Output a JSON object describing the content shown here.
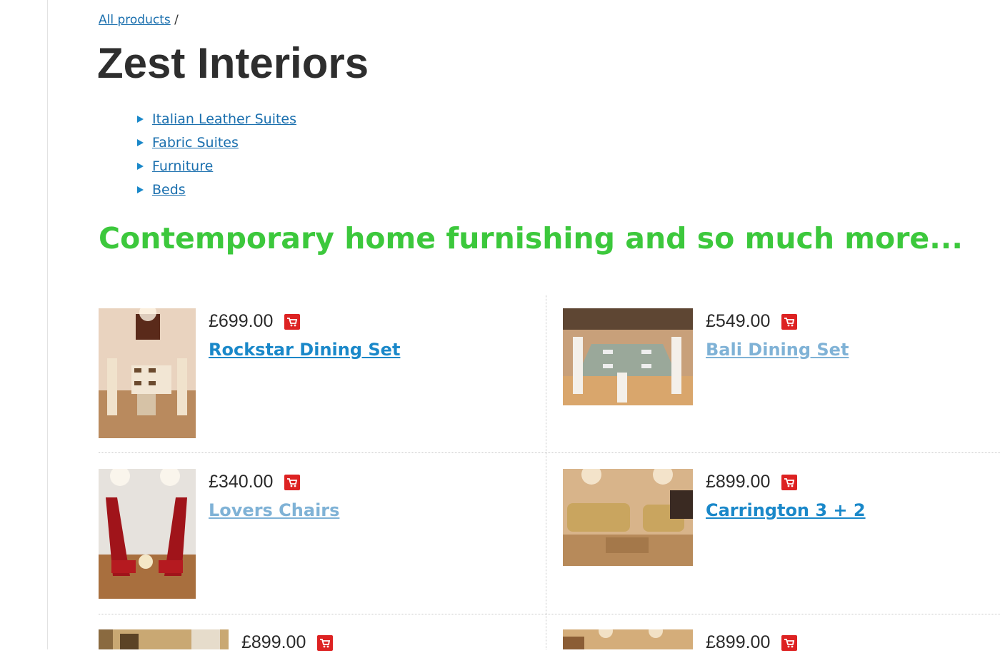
{
  "breadcrumb": {
    "link": "All products",
    "separator": "/"
  },
  "page_title": "Zest Interiors",
  "categories": [
    {
      "label": "Italian Leather Suites"
    },
    {
      "label": "Fabric Suites"
    },
    {
      "label": "Furniture"
    },
    {
      "label": "Beds"
    }
  ],
  "tagline": "Contemporary home furnishing and so much more...",
  "colors": {
    "link": "#1a6fae",
    "tagline": "#3cc83c",
    "product_link": "#1a88c9",
    "product_link_visited": "#7fb2d6",
    "cart_icon": "#dd2222"
  },
  "products": [
    {
      "price": "£699.00",
      "name": "Rockstar Dining Set",
      "image": "dining-room-photo",
      "icon": "cart-icon"
    },
    {
      "price": "£549.00",
      "name": "Bali Dining Set",
      "image": "dining-table-photo",
      "icon": "cart-icon"
    },
    {
      "price": "£340.00",
      "name": "Lovers Chairs",
      "image": "red-chairs-photo",
      "icon": "cart-icon"
    },
    {
      "price": "£899.00",
      "name": "Carrington 3 + 2",
      "image": "sofa-set-photo",
      "icon": "cart-icon"
    },
    {
      "price": "£899.00",
      "name": "",
      "image": "living-room-photo",
      "icon": "cart-icon"
    },
    {
      "price": "£899.00",
      "name": "",
      "image": "lounge-photo",
      "icon": "cart-icon"
    }
  ]
}
